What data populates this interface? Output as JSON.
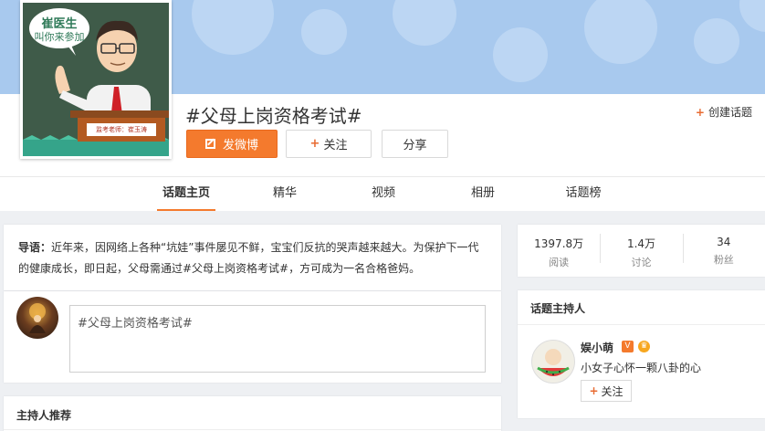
{
  "cover": {
    "bubble_line1": "崔医生",
    "bubble_line2": "叫你来参加",
    "desk_label": "监考老师：崔玉涛"
  },
  "topic": {
    "title": "#父母上岗资格考试#",
    "create_label": "创建话题"
  },
  "actions": {
    "post_label": "发微博",
    "follow_label": "关注",
    "share_label": "分享"
  },
  "tabs": [
    {
      "label": "话题主页",
      "active": true
    },
    {
      "label": "精华"
    },
    {
      "label": "视频"
    },
    {
      "label": "相册"
    },
    {
      "label": "话题榜"
    }
  ],
  "intro": {
    "lead": "导语：",
    "text": "近年来，因网络上各种“坑娃”事件屡见不鲜，宝宝们反抗的哭声越来越大。为保护下一代的健康成长，即日起，父母需通过#父母上岗资格考试#，方可成为一名合格爸妈。"
  },
  "composer": {
    "text": "#父母上岗资格考试#"
  },
  "stats": [
    {
      "value": "1397.8万",
      "label": "阅读"
    },
    {
      "value": "1.4万",
      "label": "讨论"
    },
    {
      "value": "34",
      "label": "粉丝"
    }
  ],
  "host": {
    "section_title": "话题主持人",
    "name": "娱小萌",
    "bio": "小女子心怀一颗八卦的心",
    "follow_label": "关注"
  },
  "recommend": {
    "section_title": "主持人推荐"
  },
  "colors": {
    "accent": "#f47a2d",
    "banner": "#a8c9ee"
  }
}
